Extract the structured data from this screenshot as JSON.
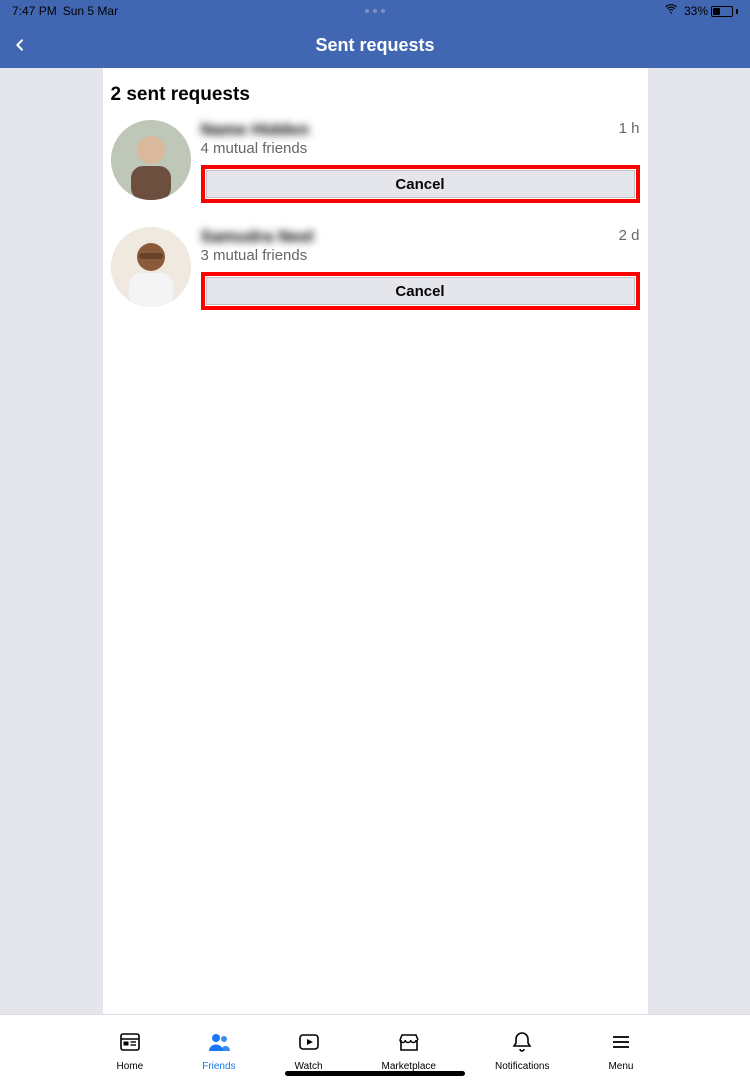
{
  "status": {
    "time": "7:47 PM",
    "date": "Sun 5 Mar",
    "battery_pct": "33%"
  },
  "header": {
    "title": "Sent requests"
  },
  "section_title": "2 sent requests",
  "requests": [
    {
      "name": "Name Hidden",
      "mutual": "4 mutual friends",
      "time": "1 h",
      "cancel_label": "Cancel"
    },
    {
      "name": "Samudra Neel",
      "mutual": "3 mutual friends",
      "time": "2 d",
      "cancel_label": "Cancel"
    }
  ],
  "tabs": {
    "home": "Home",
    "friends": "Friends",
    "watch": "Watch",
    "marketplace": "Marketplace",
    "notifications": "Notifications",
    "menu": "Menu"
  }
}
